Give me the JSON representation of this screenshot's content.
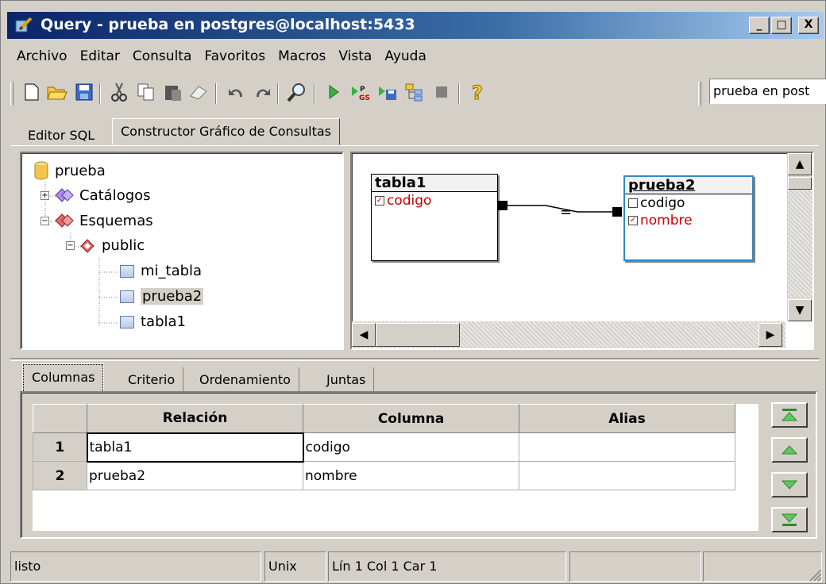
{
  "window": {
    "title": "Query - prueba en postgres@localhost:5433",
    "controls": {
      "minimize": "_",
      "maximize": "□",
      "close": "X"
    }
  },
  "menu": [
    {
      "label": "Archivo"
    },
    {
      "label": "Editar"
    },
    {
      "label": "Consulta"
    },
    {
      "label": "Favoritos"
    },
    {
      "label": "Macros"
    },
    {
      "label": "Vista"
    },
    {
      "label": "Ayuda"
    }
  ],
  "toolbar": {
    "icons": [
      "new-icon",
      "open-folder-icon",
      "save-icon",
      "cut-icon",
      "copy-icon",
      "paste-icon",
      "eraser-icon",
      "undo-icon",
      "redo-icon",
      "find-icon",
      "run-icon",
      "explain-icon",
      "run-save-icon",
      "explain-analyze-icon",
      "stop-icon",
      "help-icon"
    ],
    "connection_value": "prueba en post"
  },
  "tabs": {
    "editor": "Editor SQL",
    "builder": "Constructor Gráfico de Consultas"
  },
  "tree": {
    "root": "prueba",
    "catalogs": "Catálogos",
    "schemas": "Esquemas",
    "public": "public",
    "tables": [
      "mi_tabla",
      "prueba2",
      "tabla1"
    ]
  },
  "canvas": {
    "table1": {
      "name": "tabla1",
      "fields": [
        {
          "name": "codigo",
          "checked": true
        }
      ]
    },
    "table2": {
      "name": "prueba2",
      "fields": [
        {
          "name": "codigo",
          "checked": false
        },
        {
          "name": "nombre",
          "checked": true
        }
      ]
    },
    "join_symbol": "="
  },
  "bottom_tabs": [
    "Columnas",
    "Criterio",
    "Ordenamiento",
    "Juntas"
  ],
  "grid": {
    "headers": [
      "Relación",
      "Columna",
      "Alias"
    ],
    "rows": [
      {
        "num": "1",
        "relation": "tabla1",
        "column": "codigo",
        "alias": ""
      },
      {
        "num": "2",
        "relation": "prueba2",
        "column": "nombre",
        "alias": ""
      }
    ]
  },
  "status": {
    "text": "listo",
    "eol": "Unix",
    "position": "Lín 1 Col 1 Car 1"
  },
  "colors": {
    "title_start": "#0a246a",
    "selected_field": "#cc0000",
    "selected_table_border": "#2e8bc0"
  }
}
